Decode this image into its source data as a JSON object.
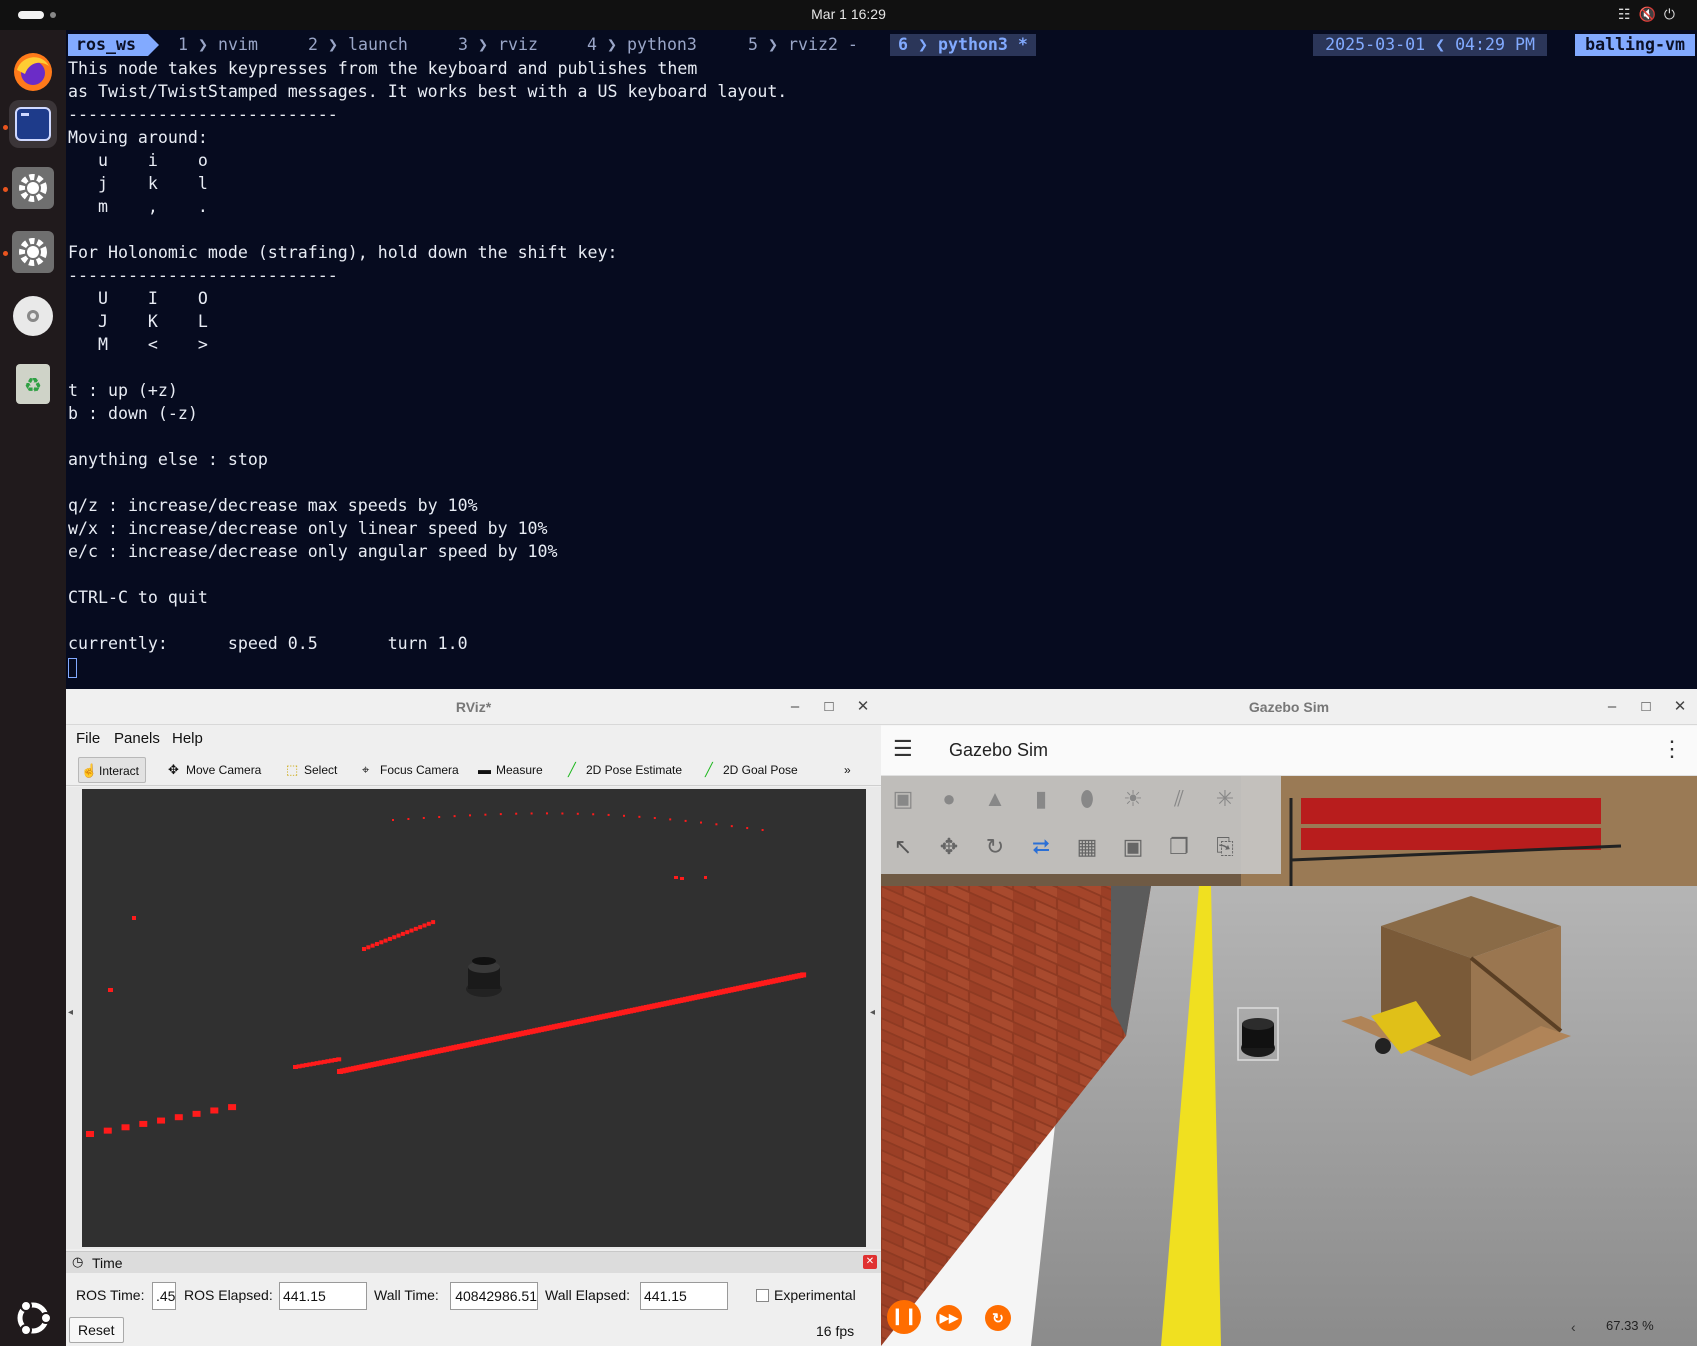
{
  "topbar": {
    "clock": "Mar 1  16:29"
  },
  "dock": {
    "items": [
      "firefox-icon",
      "terminal-icon",
      "settings-icon",
      "settings-icon",
      "optical-disc-icon",
      "trash-icon",
      "ubuntu-icon"
    ]
  },
  "terminal": {
    "session": "ros_ws",
    "tabs": [
      {
        "num": "1",
        "name": "nvim"
      },
      {
        "num": "2",
        "name": "launch"
      },
      {
        "num": "3",
        "name": "rviz"
      },
      {
        "num": "4",
        "name": "python3"
      },
      {
        "num": "5",
        "name": "rviz2 -"
      },
      {
        "num": "6",
        "name": "python3 *"
      }
    ],
    "date": "2025-03-01",
    "time": "04:29 PM",
    "host": "balling-vm",
    "lines": [
      "This node takes keypresses from the keyboard and publishes them",
      "as Twist/TwistStamped messages. It works best with a US keyboard layout.",
      "---------------------------",
      "Moving around:",
      "   u    i    o",
      "   j    k    l",
      "   m    ,    .",
      "",
      "For Holonomic mode (strafing), hold down the shift key:",
      "---------------------------",
      "   U    I    O",
      "   J    K    L",
      "   M    <    >",
      "",
      "t : up (+z)",
      "b : down (-z)",
      "",
      "anything else : stop",
      "",
      "q/z : increase/decrease max speeds by 10%",
      "w/x : increase/decrease only linear speed by 10%",
      "e/c : increase/decrease only angular speed by 10%",
      "",
      "CTRL-C to quit",
      "",
      "currently:      speed 0.5       turn 1.0"
    ]
  },
  "rviz": {
    "title": "RViz*",
    "menu": [
      "File",
      "Panels",
      "Help"
    ],
    "tools": [
      "Interact",
      "Move Camera",
      "Select",
      "Focus Camera",
      "Measure",
      "2D Pose Estimate",
      "2D Goal Pose"
    ],
    "time_panel": {
      "title": "Time",
      "ros_time_label": "ROS Time:",
      "ros_time": ".45",
      "ros_elapsed_label": "ROS Elapsed:",
      "ros_elapsed": "441.15",
      "wall_time_label": "Wall Time:",
      "wall_time": "40842986.51",
      "wall_elapsed_label": "Wall Elapsed:",
      "wall_elapsed": "441.15",
      "experimental": "Experimental",
      "reset": "Reset",
      "fps": "16 fps"
    }
  },
  "gazebo": {
    "title": "Gazebo Sim",
    "header": "Gazebo Sim",
    "rtf": "67.33 %"
  }
}
